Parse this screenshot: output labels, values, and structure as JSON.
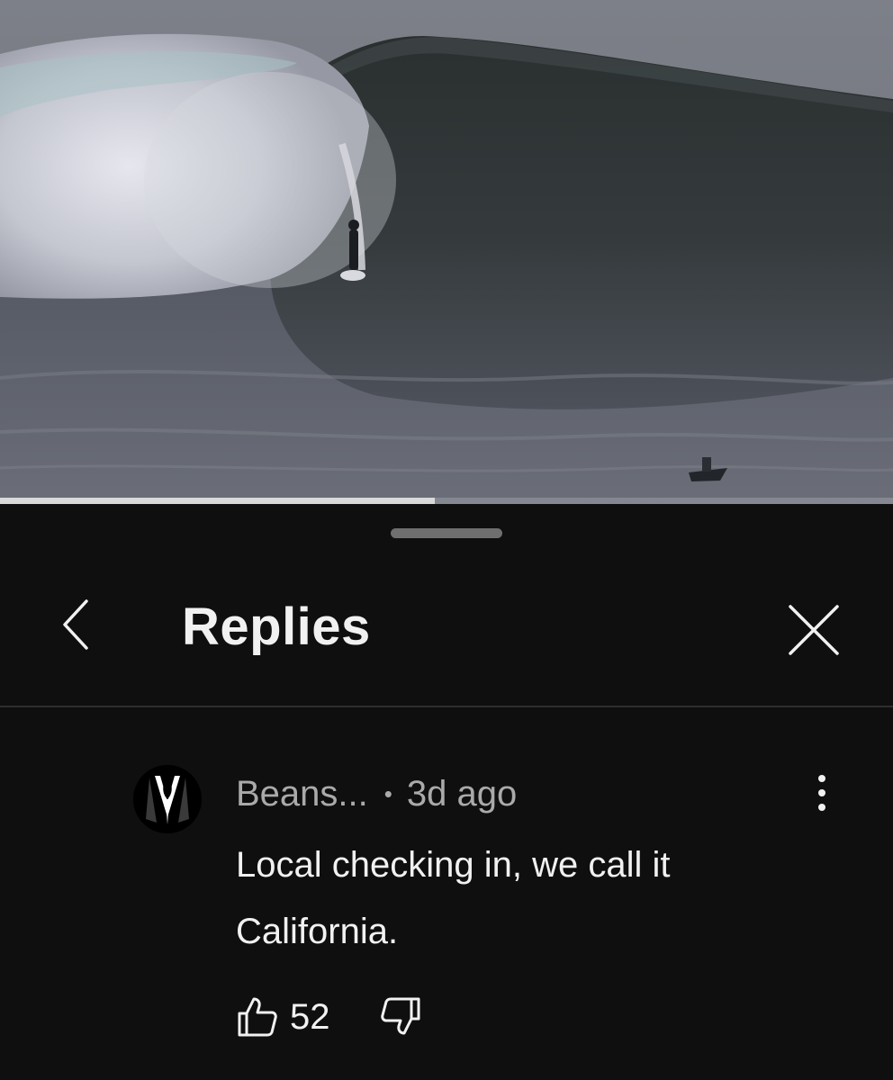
{
  "video": {
    "progress_fraction": 0.487,
    "scene": "surfer-riding-large-wave"
  },
  "sheet": {
    "title": "Replies",
    "back_icon": "chevron-left-icon",
    "close_icon": "close-icon"
  },
  "comment": {
    "author": "Beans...",
    "separator": "•",
    "time": "3d ago",
    "text": "Local checking in, we call it California.",
    "likes": "52",
    "avatar_icon": "tuxedo-avatar-icon",
    "more_icon": "more-vertical-icon",
    "like_icon": "thumbs-up-icon",
    "dislike_icon": "thumbs-down-icon"
  },
  "colors": {
    "background": "#0f0f0f",
    "primary_text": "#f1f1f1",
    "secondary_text": "#aaaaaa",
    "divider": "#2e2e2e"
  }
}
